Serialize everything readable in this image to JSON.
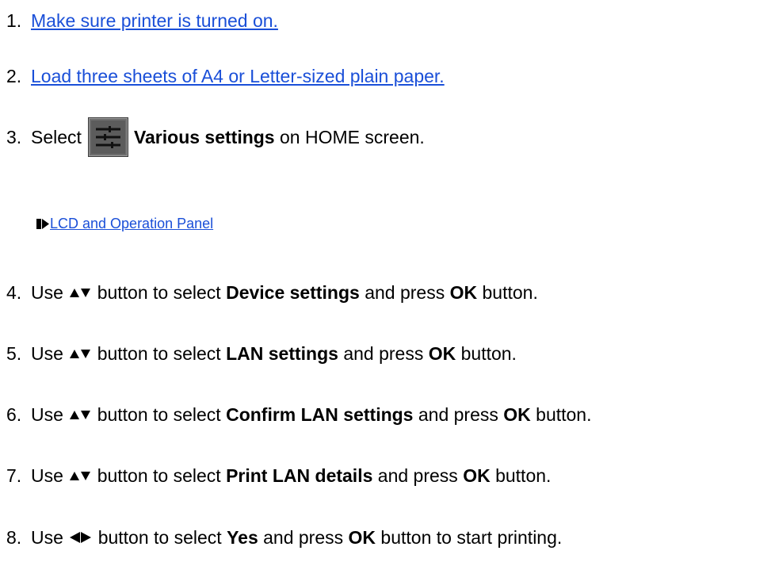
{
  "steps": [
    {
      "num": "1.",
      "link": "Make sure printer is turned on."
    },
    {
      "num": "2.",
      "link": "Load three sheets of A4 or Letter-sized plain paper."
    },
    {
      "num": "3.",
      "pre": "Select",
      "bold": "Various settings",
      "post": "on HOME screen.",
      "icon": "various-settings-icon",
      "sublink": "LCD and Operation Panel"
    },
    {
      "num": "4.",
      "pre": "Use",
      "post1": "button to select",
      "bold": "Device settings",
      "mid": "and press",
      "ok": "OK",
      "post": "button."
    },
    {
      "num": "5.",
      "pre": "Use",
      "post1": "button to select",
      "bold": "LAN settings",
      "mid": "and press",
      "ok": "OK",
      "post": "button."
    },
    {
      "num": "6.",
      "pre": "Use",
      "post1": "button to select",
      "bold": "Confirm LAN settings",
      "mid": "and press",
      "ok": "OK",
      "post": "button."
    },
    {
      "num": "7.",
      "pre": "Use",
      "post1": "button to select",
      "bold": "Print LAN details",
      "mid": "and press",
      "ok": "OK",
      "post": "button."
    },
    {
      "num": "8.",
      "pre": "Use",
      "post1": "button to select",
      "bold": "Yes",
      "mid": "and press",
      "ok": "OK",
      "post": "button to start printing."
    }
  ],
  "colors": {
    "link": "#1a4fd8",
    "text": "#000000"
  }
}
